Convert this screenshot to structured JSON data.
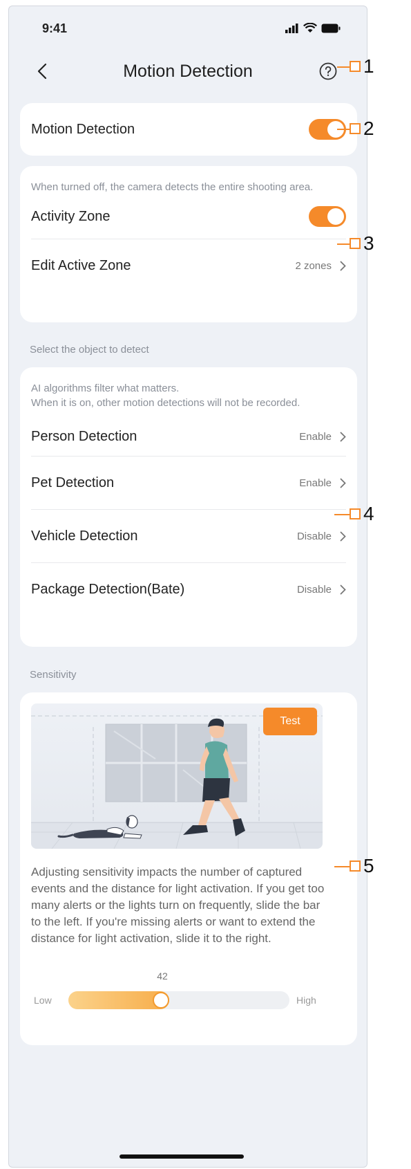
{
  "status_bar": {
    "time": "9:41"
  },
  "nav": {
    "title": "Motion Detection"
  },
  "motion_card": {
    "label": "Motion Detection",
    "enabled": true
  },
  "zone_card": {
    "hint": "When turned off, the camera detects the entire shooting area.",
    "activity_zone_label": "Activity Zone",
    "activity_zone_enabled": true,
    "edit_zone_label": "Edit Active Zone",
    "edit_zone_value": "2 zones"
  },
  "object_section": {
    "label": "Select the object to detect",
    "hint_line1": "AI algorithms filter what matters.",
    "hint_line2": "When it is on, other motion detections will not be recorded.",
    "items": [
      {
        "label": "Person Detection",
        "value": "Enable"
      },
      {
        "label": "Pet Detection",
        "value": "Enable"
      },
      {
        "label": "Vehicle Detection",
        "value": "Disable"
      },
      {
        "label": "Package Detection(Bate)",
        "value": "Disable"
      }
    ]
  },
  "sensitivity": {
    "section_label": "Sensitivity",
    "test_label": "Test",
    "description": "Adjusting sensitivity impacts the number of captured events and the distance for light activation. If you get too many alerts or the lights turn on frequently, slide the bar to the left. If you're missing alerts or want to extend the distance for light activation, slide it to the right.",
    "value": 42,
    "value_text": "42",
    "min_value": 0,
    "max_value": 100,
    "low_label": "Low",
    "high_label": "High"
  },
  "callouts": [
    "1",
    "2",
    "3",
    "4",
    "5"
  ],
  "colors": {
    "accent": "#f58a2a",
    "background": "#eef1f6",
    "card": "#ffffff"
  }
}
